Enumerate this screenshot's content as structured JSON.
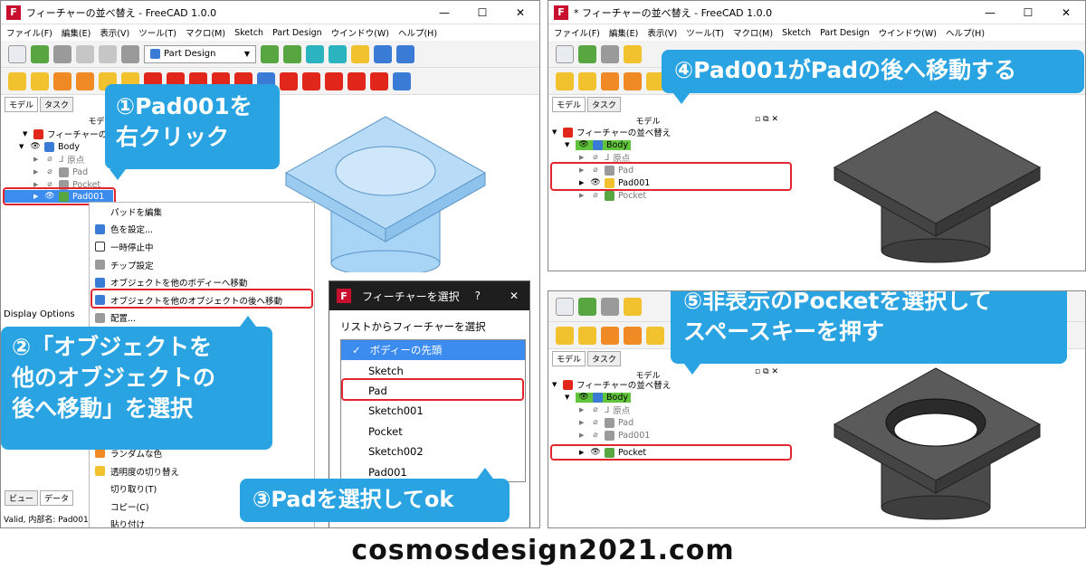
{
  "left": {
    "title": "フィーチャーの並べ替え - FreeCAD 1.0.0",
    "window_controls": [
      "—",
      "☐",
      "✕"
    ],
    "menu": [
      "ファイル(F)",
      "編集(E)",
      "表示(V)",
      "ツール(T)",
      "マクロ(M)",
      "Sketch",
      "Part Design",
      "ウインドウ(W)",
      "ヘルプ(H)"
    ],
    "workbench": "Part Design",
    "tabs": [
      "モデル",
      "タスク"
    ],
    "panel_title": "モデル",
    "tree": {
      "doc": "フィーチャーの並べ替え",
      "body": "Body",
      "origin": "原点",
      "pad": "Pad",
      "pocket": "Pocket",
      "pad001": "Pad001"
    },
    "display_options": "Display Options",
    "bottom_tabs": [
      "ビュー",
      "データ"
    ],
    "status": "Valid, 内部名: Pad001",
    "context_menu": [
      "パッドを編集",
      "色を設定...",
      "一時停止中",
      "チップ設定",
      "オブジェクトを他のボディーへ移動",
      "オブジェクトを他のオブジェクトの後へ移動",
      "配置...",
      "ランダムな色",
      "透明度の切り替え",
      "切り取り(T)",
      "コピー(C)",
      "貼り付け"
    ],
    "dialog": {
      "title": "フィーチャーを選択",
      "help": "?",
      "close": "✕",
      "label": "リストからフィーチャーを選択",
      "items": [
        "ボディーの先頭",
        "Sketch",
        "Pad",
        "Sketch001",
        "Pocket",
        "Sketch002",
        "Pad001"
      ],
      "selected_mark": "✓"
    },
    "callouts": {
      "c1": "①Pad001を\n右クリック",
      "c2": "②「オブジェクトを\n他のオブジェクトの\n後へ移動」を選択",
      "c3": "③Padを選択してok"
    }
  },
  "right_top": {
    "title": "* フィーチャーの並べ替え - FreeCAD 1.0.0",
    "menu": [
      "ファイル(F)",
      "編集(E)",
      "表示(V)",
      "ツール(T)",
      "マクロ(M)",
      "Sketch",
      "Part Design",
      "ウインドウ(W)",
      "ヘルプ(H)"
    ],
    "tabs": [
      "モデル",
      "タスク"
    ],
    "panel_title": "モデル",
    "tree": {
      "doc": "フィーチャーの並べ替え",
      "body": "Body",
      "origin": "原点",
      "pad": "Pad",
      "pad001": "Pad001",
      "pocket": "Pocket"
    },
    "callout": "④Pad001がPadの後へ移動する"
  },
  "right_bottom": {
    "tabs": [
      "モデル",
      "タスク"
    ],
    "panel_title": "モデル",
    "tree": {
      "doc": "フィーチャーの並べ替え",
      "body": "Body",
      "origin": "原点",
      "pad": "Pad",
      "pad001": "Pad001",
      "pocket": "Pocket"
    },
    "callout": "⑤非表示のPocketを選択して\nスペースキーを押す"
  },
  "footer": "cosmosdesign2021.com",
  "colors": {
    "callout": "#29a3e1",
    "highlight_box": "#e3262e",
    "body_highlight": "#61c43c",
    "selection": "#3c8cf0"
  }
}
